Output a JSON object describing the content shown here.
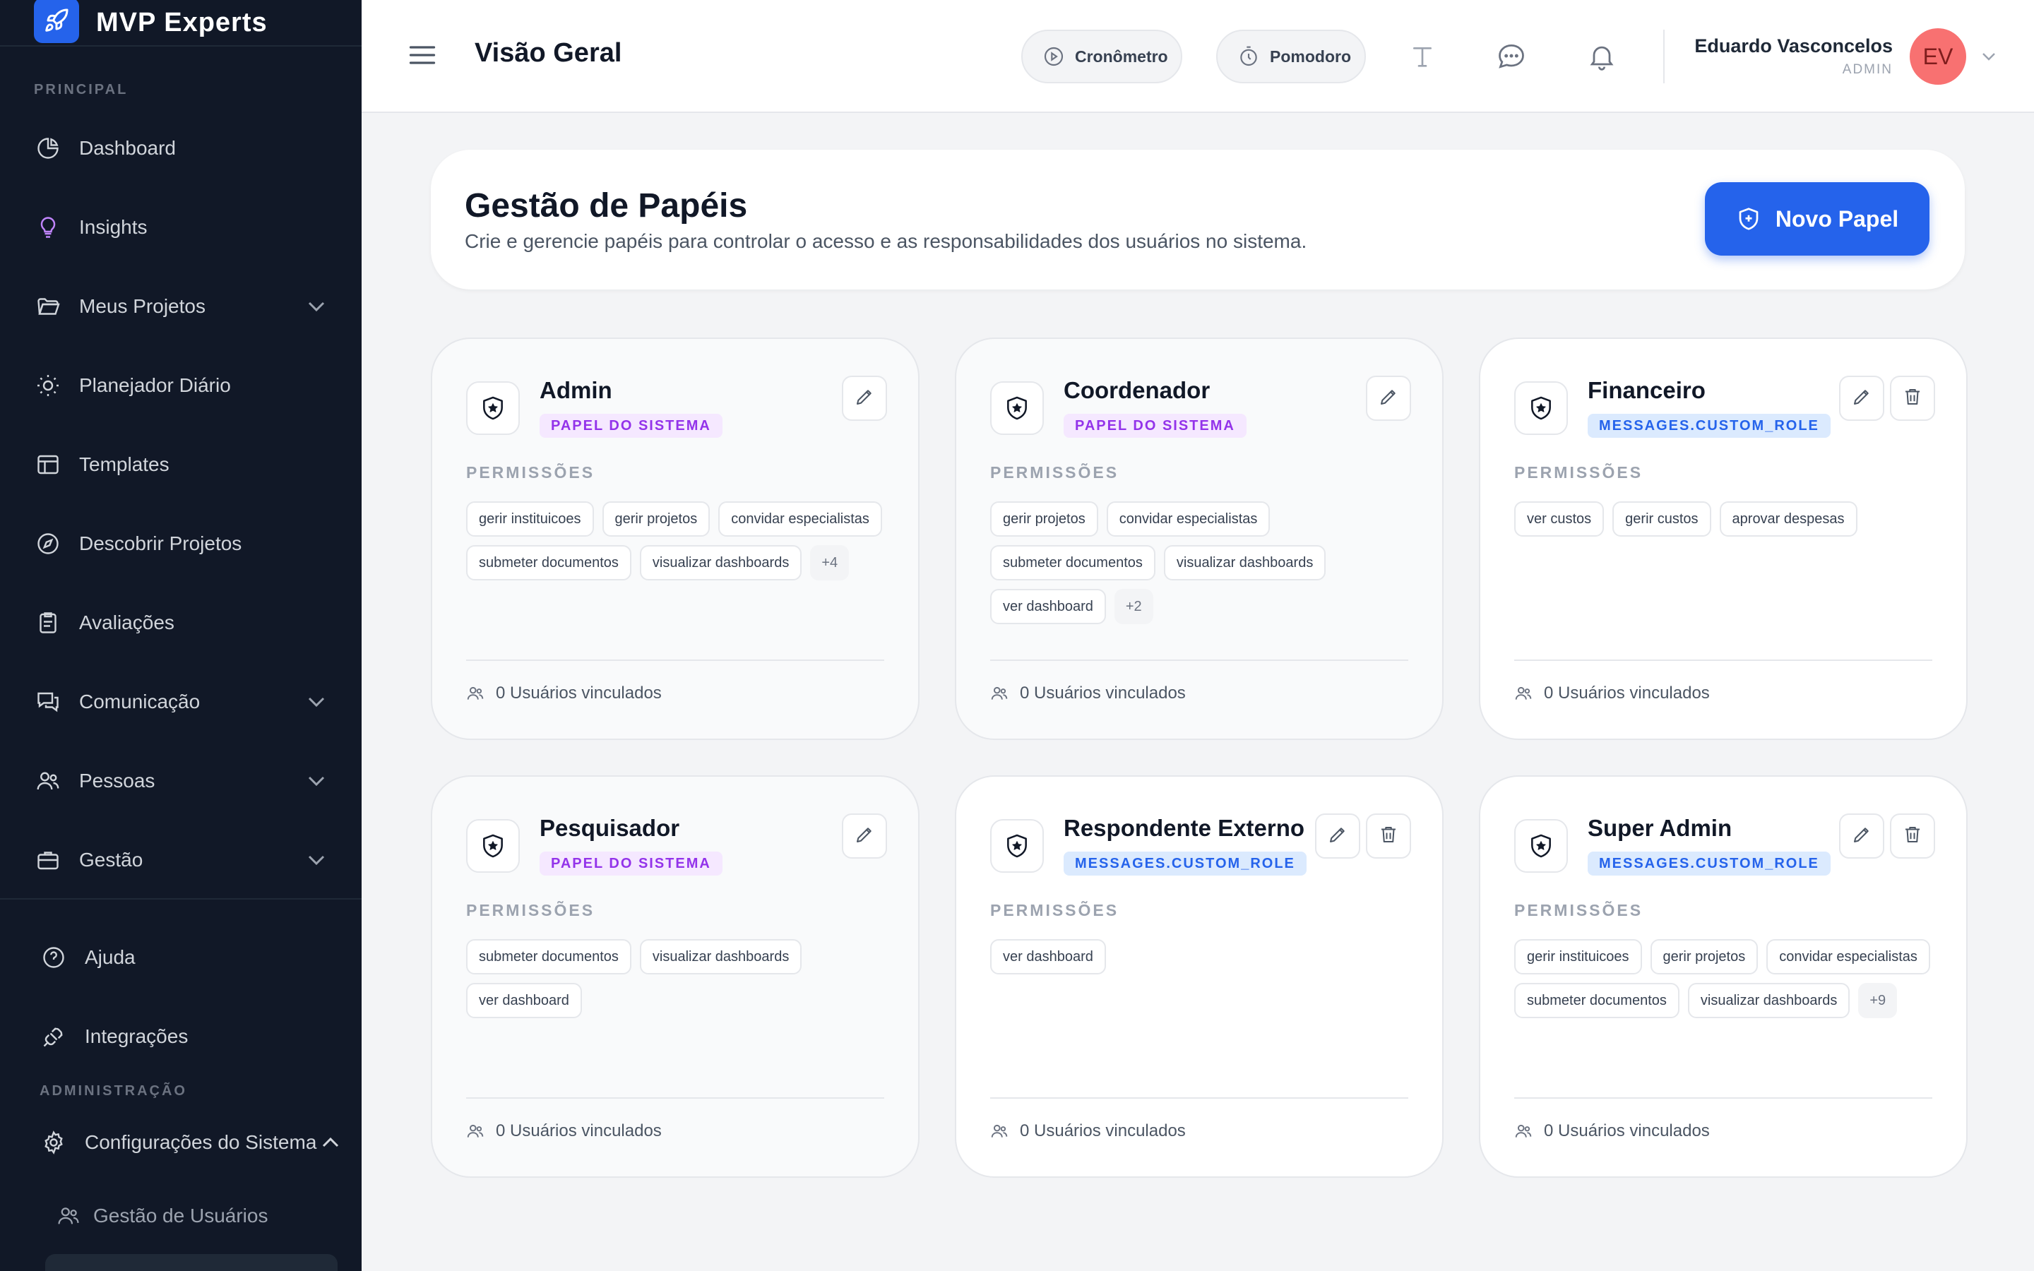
{
  "app": {
    "name": "MVP Experts"
  },
  "sidebar": {
    "section_principal": "PRINCIPAL",
    "items": [
      {
        "label": "Dashboard",
        "icon": "pie-chart-icon"
      },
      {
        "label": "Insights",
        "icon": "lightbulb-icon"
      },
      {
        "label": "Meus Projetos",
        "icon": "folder-icon",
        "expandable": true
      },
      {
        "label": "Planejador Diário",
        "icon": "sun-icon"
      },
      {
        "label": "Templates",
        "icon": "layout-icon"
      },
      {
        "label": "Descobrir Projetos",
        "icon": "compass-icon"
      },
      {
        "label": "Avaliações",
        "icon": "clipboard-icon"
      },
      {
        "label": "Comunicação",
        "icon": "chat-icon",
        "expandable": true
      },
      {
        "label": "Pessoas",
        "icon": "users-icon",
        "expandable": true
      },
      {
        "label": "Gestão",
        "icon": "briefcase-icon",
        "expandable": true
      }
    ],
    "help_label": "Ajuda",
    "integrations_label": "Integrações",
    "section_admin": "ADMINISTRAÇÃO",
    "system_settings_label": "Configurações do Sistema",
    "user_management_label": "Gestão de Usuários"
  },
  "topbar": {
    "title": "Visão Geral",
    "timer_label": "Cronômetro",
    "pomodoro_label": "Pomodoro",
    "user_name": "Eduardo Vasconcelos",
    "user_role": "ADMIN",
    "user_initials": "EV"
  },
  "page": {
    "title": "Gestão de Papéis",
    "subtitle": "Crie e gerencie papéis para controlar o acesso e as responsabilidades dos usuários no sistema.",
    "new_role_button": "Novo Papel"
  },
  "roles": [
    {
      "name": "Admin",
      "badge": "PAPEL DO SISTEMA",
      "badge_type": "system",
      "permissions_label": "PERMISSÕES",
      "permissions": [
        "gerir instituicoes",
        "gerir projetos",
        "convidar especialistas",
        "submeter documentos",
        "visualizar dashboards"
      ],
      "more": "+4",
      "users": "0 Usuários vinculados"
    },
    {
      "name": "Coordenador",
      "badge": "PAPEL DO SISTEMA",
      "badge_type": "system",
      "permissions_label": "PERMISSÕES",
      "permissions": [
        "gerir projetos",
        "convidar especialistas",
        "submeter documentos",
        "visualizar dashboards",
        "ver dashboard"
      ],
      "more": "+2",
      "users": "0 Usuários vinculados"
    },
    {
      "name": "Financeiro",
      "badge": "MESSAGES.CUSTOM_ROLE",
      "badge_type": "custom",
      "permissions_label": "PERMISSÕES",
      "permissions": [
        "ver custos",
        "gerir custos",
        "aprovar despesas"
      ],
      "more": "",
      "users": "0 Usuários vinculados"
    },
    {
      "name": "Pesquisador",
      "badge": "PAPEL DO SISTEMA",
      "badge_type": "system",
      "permissions_label": "PERMISSÕES",
      "permissions": [
        "submeter documentos",
        "visualizar dashboards",
        "ver dashboard"
      ],
      "more": "",
      "users": "0 Usuários vinculados"
    },
    {
      "name": "Respondente Externo",
      "badge": "MESSAGES.CUSTOM_ROLE",
      "badge_type": "custom",
      "permissions_label": "PERMISSÕES",
      "permissions": [
        "ver dashboard"
      ],
      "more": "",
      "users": "0 Usuários vinculados"
    },
    {
      "name": "Super Admin",
      "badge": "MESSAGES.CUSTOM_ROLE",
      "badge_type": "custom",
      "permissions_label": "PERMISSÕES",
      "permissions": [
        "gerir instituicoes",
        "gerir projetos",
        "convidar especialistas",
        "submeter documentos",
        "visualizar dashboards"
      ],
      "more": "+9",
      "users": "0 Usuários vinculados"
    }
  ],
  "colors": {
    "sidebar_bg": "#111827",
    "primary": "#2563eb",
    "system_badge": "#9333ea",
    "custom_badge": "#2563eb",
    "avatar": "#f87171"
  }
}
